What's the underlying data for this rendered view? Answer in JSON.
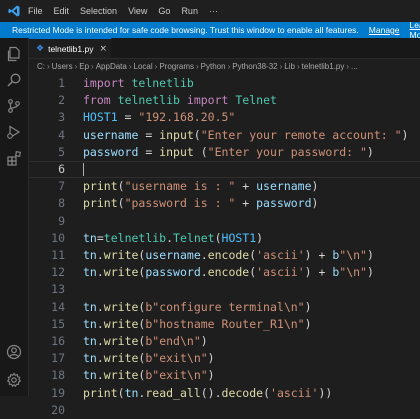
{
  "menu": [
    "File",
    "Edit",
    "Selection",
    "View",
    "Go",
    "Run",
    "···"
  ],
  "banner": {
    "message": "Restricted Mode is intended for safe code browsing. Trust this window to enable all features.",
    "manage": "Manage",
    "learn_more": "Learn More"
  },
  "tab": {
    "label": "telnetlib1.py",
    "icon": "python-file-icon"
  },
  "breadcrumb": [
    "C:",
    "Users",
    "Ep",
    "AppData",
    "Local",
    "Programs",
    "Python",
    "Python38-32",
    "Lib",
    "telnetlib1.py",
    "..."
  ],
  "activity_icons": [
    "explorer-icon",
    "search-icon",
    "source-control-icon",
    "run-debug-icon",
    "extensions-icon",
    "accounts-icon",
    "settings-gear-icon"
  ],
  "colors": {
    "banner": "#007acc",
    "keyword": "#c586c0",
    "class": "#4ec9b0",
    "variable": "#9cdcfe",
    "string": "#ce9178",
    "function": "#dcdcaa",
    "constant": "#4fc1ff"
  },
  "editor": {
    "current_line": 6,
    "lines": [
      {
        "n": "1",
        "tokens": [
          [
            "import",
            "k"
          ],
          [
            " ",
            "o"
          ],
          [
            "telnetlib",
            "n"
          ]
        ]
      },
      {
        "n": "2",
        "tokens": [
          [
            "from",
            "k"
          ],
          [
            " ",
            "o"
          ],
          [
            "telnetlib",
            "n"
          ],
          [
            " ",
            "o"
          ],
          [
            "import",
            "k"
          ],
          [
            " ",
            "o"
          ],
          [
            "Telnet",
            "n"
          ]
        ]
      },
      {
        "n": "3",
        "tokens": [
          [
            "HOST1",
            "c"
          ],
          [
            " = ",
            "o"
          ],
          [
            "\"192.168.20.5\"",
            "s"
          ]
        ]
      },
      {
        "n": "4",
        "tokens": [
          [
            "username",
            "v"
          ],
          [
            " = ",
            "o"
          ],
          [
            "input",
            "f"
          ],
          [
            "(",
            "o"
          ],
          [
            "\"Enter your remote account: \"",
            "s"
          ],
          [
            ")",
            "o"
          ]
        ]
      },
      {
        "n": "5",
        "tokens": [
          [
            "password",
            "v"
          ],
          [
            " = ",
            "o"
          ],
          [
            "input",
            "f"
          ],
          [
            " (",
            "o"
          ],
          [
            "\"Enter your password: \"",
            "s"
          ],
          [
            ")",
            "o"
          ]
        ]
      },
      {
        "n": "6",
        "tokens": []
      },
      {
        "n": "7",
        "tokens": [
          [
            "print",
            "f"
          ],
          [
            "(",
            "o"
          ],
          [
            "\"username is : \"",
            "s"
          ],
          [
            " + ",
            "o"
          ],
          [
            "username",
            "v"
          ],
          [
            ")",
            "o"
          ]
        ]
      },
      {
        "n": "8",
        "tokens": [
          [
            "print",
            "f"
          ],
          [
            "(",
            "o"
          ],
          [
            "\"password is : \"",
            "s"
          ],
          [
            " + ",
            "o"
          ],
          [
            "password",
            "v"
          ],
          [
            ")",
            "o"
          ]
        ]
      },
      {
        "n": "9",
        "tokens": []
      },
      {
        "n": "10",
        "tokens": [
          [
            "tn",
            "v"
          ],
          [
            "=",
            "o"
          ],
          [
            "telnetlib",
            "n"
          ],
          [
            ".",
            "o"
          ],
          [
            "Telnet",
            "n"
          ],
          [
            "(",
            "o"
          ],
          [
            "HOST1",
            "c"
          ],
          [
            ")",
            "o"
          ]
        ]
      },
      {
        "n": "11",
        "tokens": [
          [
            "tn",
            "v"
          ],
          [
            ".",
            "o"
          ],
          [
            "write",
            "f"
          ],
          [
            "(",
            "o"
          ],
          [
            "username",
            "v"
          ],
          [
            ".",
            "o"
          ],
          [
            "encode",
            "f"
          ],
          [
            "(",
            "o"
          ],
          [
            "'ascii'",
            "s"
          ],
          [
            ") + ",
            "o"
          ],
          [
            "b",
            "v"
          ],
          [
            "\"\\n\"",
            "s"
          ],
          [
            ")",
            "o"
          ]
        ]
      },
      {
        "n": "12",
        "tokens": [
          [
            "tn",
            "v"
          ],
          [
            ".",
            "o"
          ],
          [
            "write",
            "f"
          ],
          [
            "(",
            "o"
          ],
          [
            "password",
            "v"
          ],
          [
            ".",
            "o"
          ],
          [
            "encode",
            "f"
          ],
          [
            "(",
            "o"
          ],
          [
            "'ascii'",
            "s"
          ],
          [
            ") + ",
            "o"
          ],
          [
            "b",
            "v"
          ],
          [
            "\"\\n\"",
            "s"
          ],
          [
            ")",
            "o"
          ]
        ]
      },
      {
        "n": "13",
        "tokens": []
      },
      {
        "n": "14",
        "tokens": [
          [
            "tn",
            "v"
          ],
          [
            ".",
            "o"
          ],
          [
            "write",
            "f"
          ],
          [
            "(",
            "o"
          ],
          [
            "b\"configure terminal\\n\"",
            "s"
          ],
          [
            ")",
            "o"
          ]
        ]
      },
      {
        "n": "15",
        "tokens": [
          [
            "tn",
            "v"
          ],
          [
            ".",
            "o"
          ],
          [
            "write",
            "f"
          ],
          [
            "(",
            "o"
          ],
          [
            "b\"hostname Router_R1\\n\"",
            "s"
          ],
          [
            ")",
            "o"
          ]
        ]
      },
      {
        "n": "16",
        "tokens": [
          [
            "tn",
            "v"
          ],
          [
            ".",
            "o"
          ],
          [
            "write",
            "f"
          ],
          [
            "(",
            "o"
          ],
          [
            "b\"end\\n\"",
            "s"
          ],
          [
            ")",
            "o"
          ]
        ]
      },
      {
        "n": "17",
        "tokens": [
          [
            "tn",
            "v"
          ],
          [
            ".",
            "o"
          ],
          [
            "write",
            "f"
          ],
          [
            "(",
            "o"
          ],
          [
            "b\"exit\\n\"",
            "s"
          ],
          [
            ")",
            "o"
          ]
        ]
      },
      {
        "n": "18",
        "tokens": [
          [
            "tn",
            "v"
          ],
          [
            ".",
            "o"
          ],
          [
            "write",
            "f"
          ],
          [
            "(",
            "o"
          ],
          [
            "b\"exit\\n\"",
            "s"
          ],
          [
            ")",
            "o"
          ]
        ]
      },
      {
        "n": "19",
        "tokens": [
          [
            "print",
            "f"
          ],
          [
            "(",
            "o"
          ],
          [
            "tn",
            "v"
          ],
          [
            ".",
            "o"
          ],
          [
            "read_all",
            "f"
          ],
          [
            "().",
            "o"
          ],
          [
            "decode",
            "f"
          ],
          [
            "(",
            "o"
          ],
          [
            "'ascii'",
            "s"
          ],
          [
            "))",
            "o"
          ]
        ]
      },
      {
        "n": "20",
        "tokens": []
      }
    ]
  }
}
